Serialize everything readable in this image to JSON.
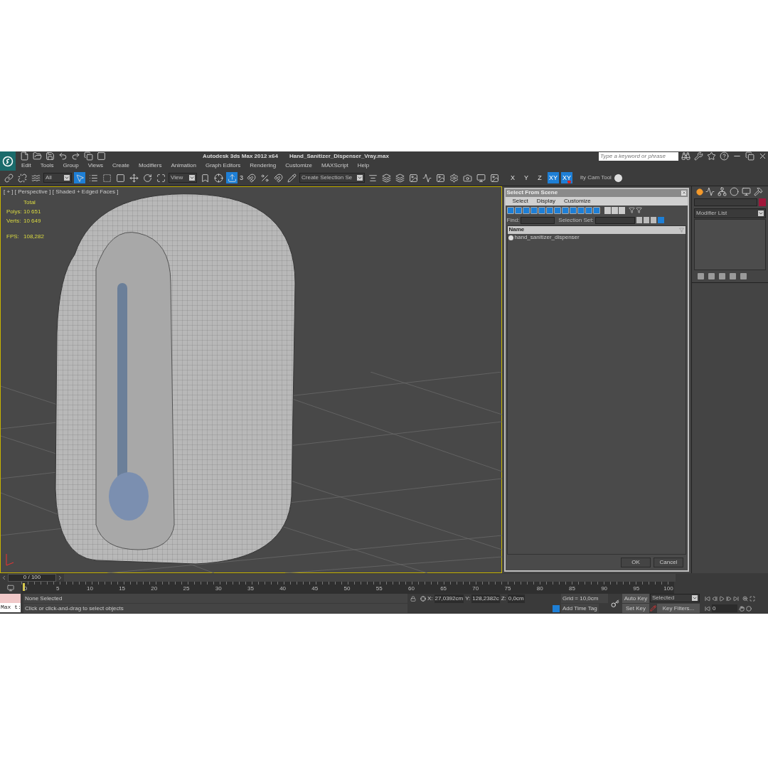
{
  "app": {
    "title": "Autodesk 3ds Max  2012 x64",
    "file": "Hand_Sanitizer_Dispenser_Vray.max",
    "search_placeholder": "Type a keyword or phrase"
  },
  "menu": [
    "Edit",
    "Tools",
    "Group",
    "Views",
    "Create",
    "Modifiers",
    "Animation",
    "Graph Editors",
    "Rendering",
    "Customize",
    "MAXScript",
    "Help"
  ],
  "toolbar": {
    "selection_filter": "All",
    "reference_coord": "View",
    "named_selection": "Create Selection Se",
    "snap_label": "3",
    "axes": [
      {
        "label": "X",
        "selected": false,
        "kind": "plain"
      },
      {
        "label": "Y",
        "selected": false,
        "kind": "plain"
      },
      {
        "label": "Z",
        "selected": false,
        "kind": "plain"
      },
      {
        "label": "XY",
        "selected": true,
        "kind": "plain"
      },
      {
        "label": "XY",
        "selected": true,
        "kind": "magnet"
      }
    ],
    "tool_label": "ity Cam Tool"
  },
  "viewport": {
    "label": "[ + ] [ Perspective ] [ Shaded + Edged Faces ]",
    "stats_header": "Total",
    "stats": [
      {
        "label": "Polys:",
        "value": "10 651"
      },
      {
        "label": "Verts:",
        "value": "10 649"
      }
    ],
    "fps_label": "FPS:",
    "fps": "108,282"
  },
  "dialog": {
    "title": "Select From Scene",
    "menu": [
      "Select",
      "Display",
      "Customize"
    ],
    "find_label": "Find:",
    "selection_set_label": "Selection Set:",
    "column": "Name",
    "items": [
      {
        "name": "hand_sanitizer_dispenser",
        "selected": false
      }
    ],
    "buttons": [
      "OK",
      "Cancel"
    ]
  },
  "command_panel": {
    "modifier_list": "Modifier List"
  },
  "timeline": {
    "frame": "0 / 100",
    "ticks": [
      "0",
      "5",
      "10",
      "15",
      "20",
      "25",
      "30",
      "35",
      "40",
      "45",
      "50",
      "55",
      "60",
      "65",
      "70",
      "75",
      "80",
      "85",
      "90",
      "95",
      "100"
    ]
  },
  "status": {
    "selection": "None Selected",
    "prompt": "Click or click-and-drag to select objects",
    "listener": "Max t:",
    "x_label": "X:",
    "x": "27,0392cm",
    "y_label": "Y:",
    "y": "128,2382c",
    "z_label": "Z:",
    "z": "0,0cm",
    "grid": "Grid = 10,0cm",
    "add_time_tag": "Add Time Tag",
    "auto_key": "Auto Key",
    "set_key": "Set Key",
    "key_mode": "Selected",
    "key_filters": "Key Filters...",
    "frame": "0"
  }
}
